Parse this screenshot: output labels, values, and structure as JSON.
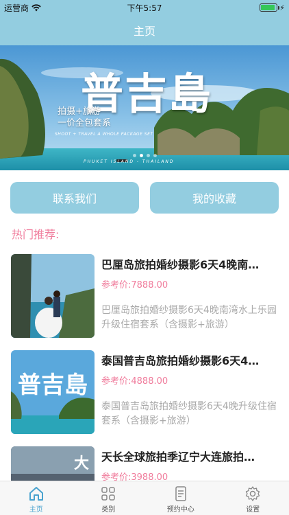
{
  "status_bar": {
    "carrier": "运营商",
    "time": "下午5:57",
    "battery_level": 0.9,
    "colors": {
      "battery": "#35c759"
    }
  },
  "nav": {
    "title": "主页"
  },
  "banner": {
    "title": "普吉島",
    "tag_line1": "拍摄+旅游",
    "tag_line2": "一价全包套系",
    "subtitle": "SHOOT + TRAVEL A WHOLE PACKAGE SET",
    "footer": "PHUKET ISLAND - THAILAND",
    "slide_count": 4,
    "active_slide": 1
  },
  "actions": {
    "contact_label": "联系我们",
    "favorites_label": "我的收藏"
  },
  "section": {
    "title": "热门推荐:"
  },
  "products": [
    {
      "title": "巴厘岛旅拍婚纱摄影6天4晚南…",
      "price": "参考价:7888.00",
      "desc": "巴厘岛旅拍婚纱摄影6天4晚南湾水上乐园升级住宿套系（含摄影+旅游）"
    },
    {
      "title": "泰国普吉岛旅拍婚纱摄影6天4…",
      "price": "参考价:4888.00",
      "desc": "泰国普吉岛旅拍婚纱摄影6天4晚升级住宿套系（含摄影+旅游）",
      "image_text": "普吉島"
    },
    {
      "title": "天长全球旅拍季辽宁大连旅拍…",
      "price": "参考价:3988.00",
      "desc": "",
      "image_text": "大"
    }
  ],
  "tabs": [
    {
      "label": "主页",
      "icon": "home-icon",
      "active": true
    },
    {
      "label": "类别",
      "icon": "grid-icon",
      "active": false
    },
    {
      "label": "预约中心",
      "icon": "clipboard-icon",
      "active": false
    },
    {
      "label": "设置",
      "icon": "gear-icon",
      "active": false
    }
  ],
  "colors": {
    "primary": "#93cde0",
    "accent_pink": "#f07c9c",
    "tab_active": "#4aa3cf"
  }
}
